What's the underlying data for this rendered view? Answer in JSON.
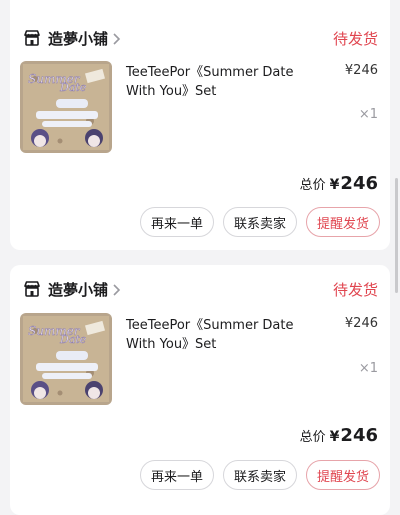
{
  "orders": [
    {
      "store_name": "造夢小铺",
      "status": "待发货",
      "product_title": "TeeTeePor《Summer Date With You》Set",
      "unit_price": "¥246",
      "quantity": "×1",
      "total_label": "总价",
      "total_currency": "¥",
      "total_value": "246",
      "buttons": {
        "again": "再来一单",
        "contact": "联系卖家",
        "remind": "提醒发货"
      }
    },
    {
      "store_name": "造夢小铺",
      "status": "待发货",
      "product_title": "TeeTeePor《Summer Date With You》Set",
      "unit_price": "¥246",
      "quantity": "×1",
      "total_label": "总价",
      "total_currency": "¥",
      "total_value": "246",
      "buttons": {
        "again": "再来一单",
        "contact": "联系卖家",
        "remind": "提醒发货"
      }
    }
  ],
  "colors": {
    "status": "#e0454f",
    "remind_border": "#e7a4aa",
    "page_bg": "#f3f3f5"
  },
  "icons": {
    "store": "store-icon",
    "chevron": "chevron-right-icon"
  }
}
